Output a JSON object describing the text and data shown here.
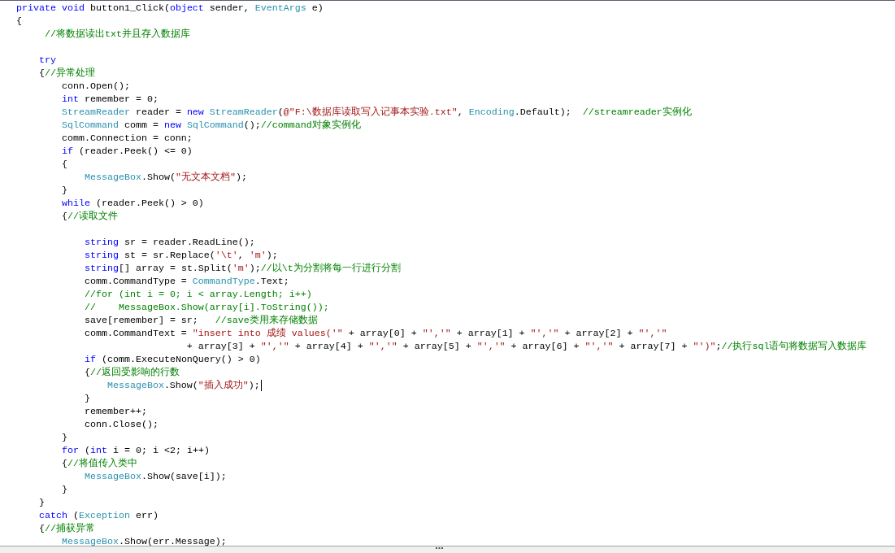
{
  "editor": {
    "lines": [
      {
        "kind": "code",
        "cursor": false,
        "tokens": [
          {
            "kind": "kw",
            "text": "private"
          },
          {
            "kind": "kw",
            "text": " void"
          },
          {
            "kind": "plain",
            "text": " button1_Click("
          },
          {
            "kind": "kw",
            "text": "object"
          },
          {
            "kind": "plain",
            "text": " sender, "
          },
          {
            "kind": "type",
            "text": "EventArgs"
          },
          {
            "kind": "plain",
            "text": " e)"
          }
        ]
      },
      {
        "kind": "code",
        "cursor": false,
        "tokens": [
          {
            "kind": "plain",
            "text": "{"
          }
        ]
      },
      {
        "kind": "code",
        "cursor": false,
        "tokens": [
          {
            "kind": "cmt",
            "text": "     //将数据读出txt并且存入数据库"
          }
        ]
      },
      {
        "kind": "blank",
        "cursor": false
      },
      {
        "kind": "code",
        "cursor": false,
        "tokens": [
          {
            "kind": "kw",
            "text": "    try"
          }
        ]
      },
      {
        "kind": "code",
        "cursor": false,
        "tokens": [
          {
            "kind": "plain",
            "text": "    {"
          },
          {
            "kind": "cmt",
            "text": "//异常处理"
          }
        ]
      },
      {
        "kind": "code",
        "cursor": false,
        "tokens": [
          {
            "kind": "plain",
            "text": "        conn.Open();"
          }
        ]
      },
      {
        "kind": "code",
        "cursor": false,
        "tokens": [
          {
            "kind": "kw",
            "text": "        int"
          },
          {
            "kind": "plain",
            "text": " remember = 0;"
          }
        ]
      },
      {
        "kind": "code",
        "cursor": false,
        "tokens": [
          {
            "kind": "type",
            "text": "        StreamReader"
          },
          {
            "kind": "plain",
            "text": " reader = "
          },
          {
            "kind": "kw",
            "text": "new"
          },
          {
            "kind": "type",
            "text": " StreamReader"
          },
          {
            "kind": "plain",
            "text": "("
          },
          {
            "kind": "str",
            "text": "@\"F:\\数据库读取写入记事本实验.txt\""
          },
          {
            "kind": "plain",
            "text": ", "
          },
          {
            "kind": "type",
            "text": "Encoding"
          },
          {
            "kind": "plain",
            "text": ".Default);  "
          },
          {
            "kind": "cmt",
            "text": "//streamreader实例化"
          }
        ]
      },
      {
        "kind": "code",
        "cursor": false,
        "tokens": [
          {
            "kind": "type",
            "text": "        SqlCommand"
          },
          {
            "kind": "plain",
            "text": " comm = "
          },
          {
            "kind": "kw",
            "text": "new"
          },
          {
            "kind": "type",
            "text": " SqlCommand"
          },
          {
            "kind": "plain",
            "text": "();"
          },
          {
            "kind": "cmt",
            "text": "//command对象实例化"
          }
        ]
      },
      {
        "kind": "code",
        "cursor": false,
        "tokens": [
          {
            "kind": "plain",
            "text": "        comm.Connection = conn;"
          }
        ]
      },
      {
        "kind": "code",
        "cursor": false,
        "tokens": [
          {
            "kind": "kw",
            "text": "        if"
          },
          {
            "kind": "plain",
            "text": " (reader.Peek() <= 0)"
          }
        ]
      },
      {
        "kind": "code",
        "cursor": false,
        "tokens": [
          {
            "kind": "plain",
            "text": "        {"
          }
        ]
      },
      {
        "kind": "code",
        "cursor": false,
        "tokens": [
          {
            "kind": "type",
            "text": "            MessageBox"
          },
          {
            "kind": "plain",
            "text": ".Show("
          },
          {
            "kind": "str",
            "text": "\"无文本文档\""
          },
          {
            "kind": "plain",
            "text": ");"
          }
        ]
      },
      {
        "kind": "code",
        "cursor": false,
        "tokens": [
          {
            "kind": "plain",
            "text": "        }"
          }
        ]
      },
      {
        "kind": "code",
        "cursor": false,
        "tokens": [
          {
            "kind": "kw",
            "text": "        while"
          },
          {
            "kind": "plain",
            "text": " (reader.Peek() > 0)"
          }
        ]
      },
      {
        "kind": "code",
        "cursor": false,
        "tokens": [
          {
            "kind": "plain",
            "text": "        {"
          },
          {
            "kind": "cmt",
            "text": "//读取文件"
          }
        ]
      },
      {
        "kind": "blank",
        "cursor": false
      },
      {
        "kind": "code",
        "cursor": false,
        "tokens": [
          {
            "kind": "kw",
            "text": "            string"
          },
          {
            "kind": "plain",
            "text": " sr = reader.ReadLine();"
          }
        ]
      },
      {
        "kind": "code",
        "cursor": false,
        "tokens": [
          {
            "kind": "kw",
            "text": "            string"
          },
          {
            "kind": "plain",
            "text": " st = sr.Replace("
          },
          {
            "kind": "str",
            "text": "'\\t'"
          },
          {
            "kind": "plain",
            "text": ", "
          },
          {
            "kind": "str",
            "text": "'m'"
          },
          {
            "kind": "plain",
            "text": ");"
          }
        ]
      },
      {
        "kind": "code",
        "cursor": false,
        "tokens": [
          {
            "kind": "kw",
            "text": "            string"
          },
          {
            "kind": "plain",
            "text": "[] array = st.Split("
          },
          {
            "kind": "str",
            "text": "'m'"
          },
          {
            "kind": "plain",
            "text": ");"
          },
          {
            "kind": "cmt",
            "text": "//以\\t为分割将每一行进行分割"
          }
        ]
      },
      {
        "kind": "code",
        "cursor": false,
        "tokens": [
          {
            "kind": "plain",
            "text": "            comm.CommandType = "
          },
          {
            "kind": "type",
            "text": "CommandType"
          },
          {
            "kind": "plain",
            "text": ".Text;"
          }
        ]
      },
      {
        "kind": "code",
        "cursor": false,
        "tokens": [
          {
            "kind": "cmt",
            "text": "            //for (int i = 0; i < array.Length; i++)"
          }
        ]
      },
      {
        "kind": "code",
        "cursor": false,
        "tokens": [
          {
            "kind": "cmt",
            "text": "            //    MessageBox.Show(array[i].ToString());"
          }
        ]
      },
      {
        "kind": "code",
        "cursor": false,
        "tokens": [
          {
            "kind": "plain",
            "text": "            save[remember] = sr;   "
          },
          {
            "kind": "cmt",
            "text": "//save类用来存储数据"
          }
        ]
      },
      {
        "kind": "code",
        "cursor": false,
        "tokens": [
          {
            "kind": "plain",
            "text": "            comm.CommandText = "
          },
          {
            "kind": "str",
            "text": "\"insert into 成绩 values('\""
          },
          {
            "kind": "plain",
            "text": " + array[0] + "
          },
          {
            "kind": "str",
            "text": "\"','\""
          },
          {
            "kind": "plain",
            "text": " + array[1] + "
          },
          {
            "kind": "str",
            "text": "\"','\""
          },
          {
            "kind": "plain",
            "text": " + array[2] + "
          },
          {
            "kind": "str",
            "text": "\"','\""
          }
        ]
      },
      {
        "kind": "code",
        "cursor": false,
        "tokens": [
          {
            "kind": "plain",
            "text": "                              + array[3] + "
          },
          {
            "kind": "str",
            "text": "\"','\""
          },
          {
            "kind": "plain",
            "text": " + array[4] + "
          },
          {
            "kind": "str",
            "text": "\"','\""
          },
          {
            "kind": "plain",
            "text": " + array[5] + "
          },
          {
            "kind": "str",
            "text": "\"','\""
          },
          {
            "kind": "plain",
            "text": " + array[6] + "
          },
          {
            "kind": "str",
            "text": "\"','\""
          },
          {
            "kind": "plain",
            "text": " + array[7] + "
          },
          {
            "kind": "str",
            "text": "\"')\""
          },
          {
            "kind": "plain",
            "text": ";"
          },
          {
            "kind": "cmt",
            "text": "//执行sql语句将数据写入数据库"
          }
        ]
      },
      {
        "kind": "code",
        "cursor": false,
        "tokens": [
          {
            "kind": "kw",
            "text": "            if"
          },
          {
            "kind": "plain",
            "text": " (comm.ExecuteNonQuery() > 0)"
          }
        ]
      },
      {
        "kind": "code",
        "cursor": false,
        "tokens": [
          {
            "kind": "plain",
            "text": "            {"
          },
          {
            "kind": "cmt",
            "text": "//返回受影响的行数"
          }
        ]
      },
      {
        "kind": "code",
        "cursor": true,
        "tokens": [
          {
            "kind": "type",
            "text": "                MessageBox"
          },
          {
            "kind": "plain",
            "text": ".Show("
          },
          {
            "kind": "str",
            "text": "\"插入成功\""
          },
          {
            "kind": "plain",
            "text": ");"
          }
        ]
      },
      {
        "kind": "code",
        "cursor": false,
        "tokens": [
          {
            "kind": "plain",
            "text": "            }"
          }
        ]
      },
      {
        "kind": "code",
        "cursor": false,
        "tokens": [
          {
            "kind": "plain",
            "text": "            remember++;"
          }
        ]
      },
      {
        "kind": "code",
        "cursor": false,
        "tokens": [
          {
            "kind": "plain",
            "text": "            conn.Close();"
          }
        ]
      },
      {
        "kind": "code",
        "cursor": false,
        "tokens": [
          {
            "kind": "plain",
            "text": "        }"
          }
        ]
      },
      {
        "kind": "code",
        "cursor": false,
        "tokens": [
          {
            "kind": "kw",
            "text": "        for"
          },
          {
            "kind": "plain",
            "text": " ("
          },
          {
            "kind": "kw",
            "text": "int"
          },
          {
            "kind": "plain",
            "text": " i = 0; i <2; i++)"
          }
        ]
      },
      {
        "kind": "code",
        "cursor": false,
        "tokens": [
          {
            "kind": "plain",
            "text": "        {"
          },
          {
            "kind": "cmt",
            "text": "//将值传入类中"
          }
        ]
      },
      {
        "kind": "code",
        "cursor": false,
        "tokens": [
          {
            "kind": "type",
            "text": "            MessageBox"
          },
          {
            "kind": "plain",
            "text": ".Show(save[i]);"
          }
        ]
      },
      {
        "kind": "code",
        "cursor": false,
        "tokens": [
          {
            "kind": "plain",
            "text": "        }"
          }
        ]
      },
      {
        "kind": "code",
        "cursor": false,
        "tokens": [
          {
            "kind": "plain",
            "text": "    }"
          }
        ]
      },
      {
        "kind": "code",
        "cursor": false,
        "tokens": [
          {
            "kind": "kw",
            "text": "    catch"
          },
          {
            "kind": "plain",
            "text": " ("
          },
          {
            "kind": "type",
            "text": "Exception"
          },
          {
            "kind": "plain",
            "text": " err)"
          }
        ]
      },
      {
        "kind": "code",
        "cursor": false,
        "tokens": [
          {
            "kind": "plain",
            "text": "    {"
          },
          {
            "kind": "cmt",
            "text": "//捕获异常"
          }
        ]
      },
      {
        "kind": "code",
        "cursor": false,
        "tokens": [
          {
            "kind": "type",
            "text": "        MessageBox"
          },
          {
            "kind": "plain",
            "text": ".Show(err.Message);"
          }
        ]
      }
    ]
  }
}
